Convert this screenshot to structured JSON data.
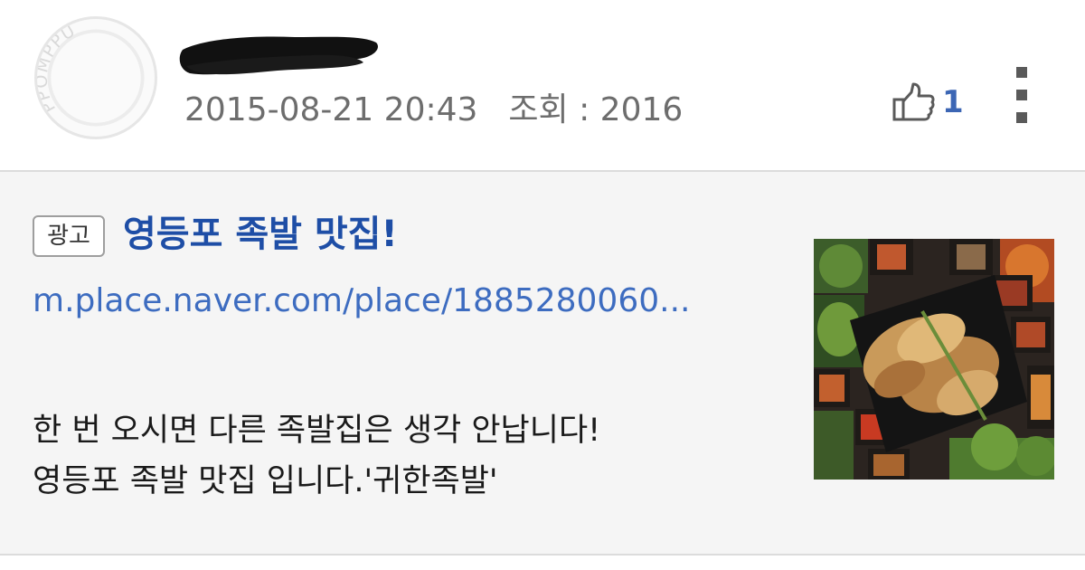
{
  "post": {
    "author_avatar_icon": "ppomppu-logo-avatar",
    "avatar_watermark": "PPOMPPU",
    "author_name_redacted": true,
    "date": "2015-08-21 20:43",
    "views": "조회 : 2016",
    "like_icon": "thumbs-up-icon",
    "like_count": "1",
    "more_icon": "kebab-menu-icon"
  },
  "ad": {
    "badge": "광고",
    "title": "영등포 족발 맛집!",
    "url": "m.place.naver.com/place/1885280060...",
    "description": [
      "한 번 오시면 다른 족발집은 생각 안납니다!",
      "영등포 족발 맛집 입니다.'귀한족발'"
    ],
    "thumbnail_icon": "jokbal-food-photo"
  },
  "colors": {
    "ad_title": "#1e4ea6",
    "ad_url": "#3d6cc0",
    "like_accent": "#3c66b4",
    "meta_text": "#6d6d6d"
  }
}
